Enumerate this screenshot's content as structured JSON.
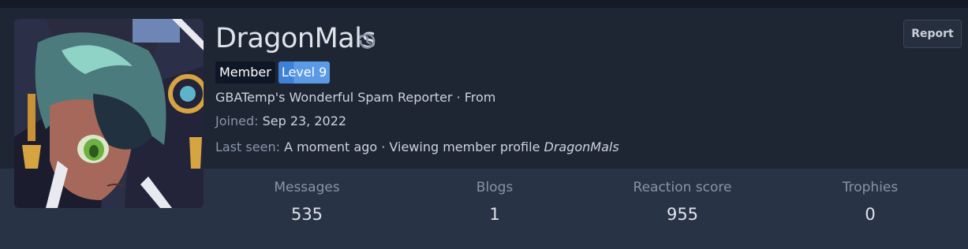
{
  "profile": {
    "username": "DragonMals",
    "badges": {
      "member": "Member",
      "level": "Level 9"
    },
    "title_line": "GBATemp's Wonderful Spam Reporter · From",
    "joined_label": "Joined:",
    "joined_value": "Sep 23, 2022",
    "last_seen_label": "Last seen:",
    "last_seen_value": "A moment ago · Viewing member profile",
    "last_seen_target": "DragonMals",
    "report_label": "Report"
  },
  "stats": [
    {
      "label": "Messages",
      "value": "535"
    },
    {
      "label": "Blogs",
      "value": "1"
    },
    {
      "label": "Reaction score",
      "value": "955"
    },
    {
      "label": "Trophies",
      "value": "0"
    }
  ],
  "icons": {
    "history": "history-icon",
    "avatar": "avatar-image"
  },
  "colors": {
    "background": "#1e2634",
    "stats_band": "#283346",
    "level_badge": "#3e82d8",
    "member_badge": "#0f1726"
  }
}
